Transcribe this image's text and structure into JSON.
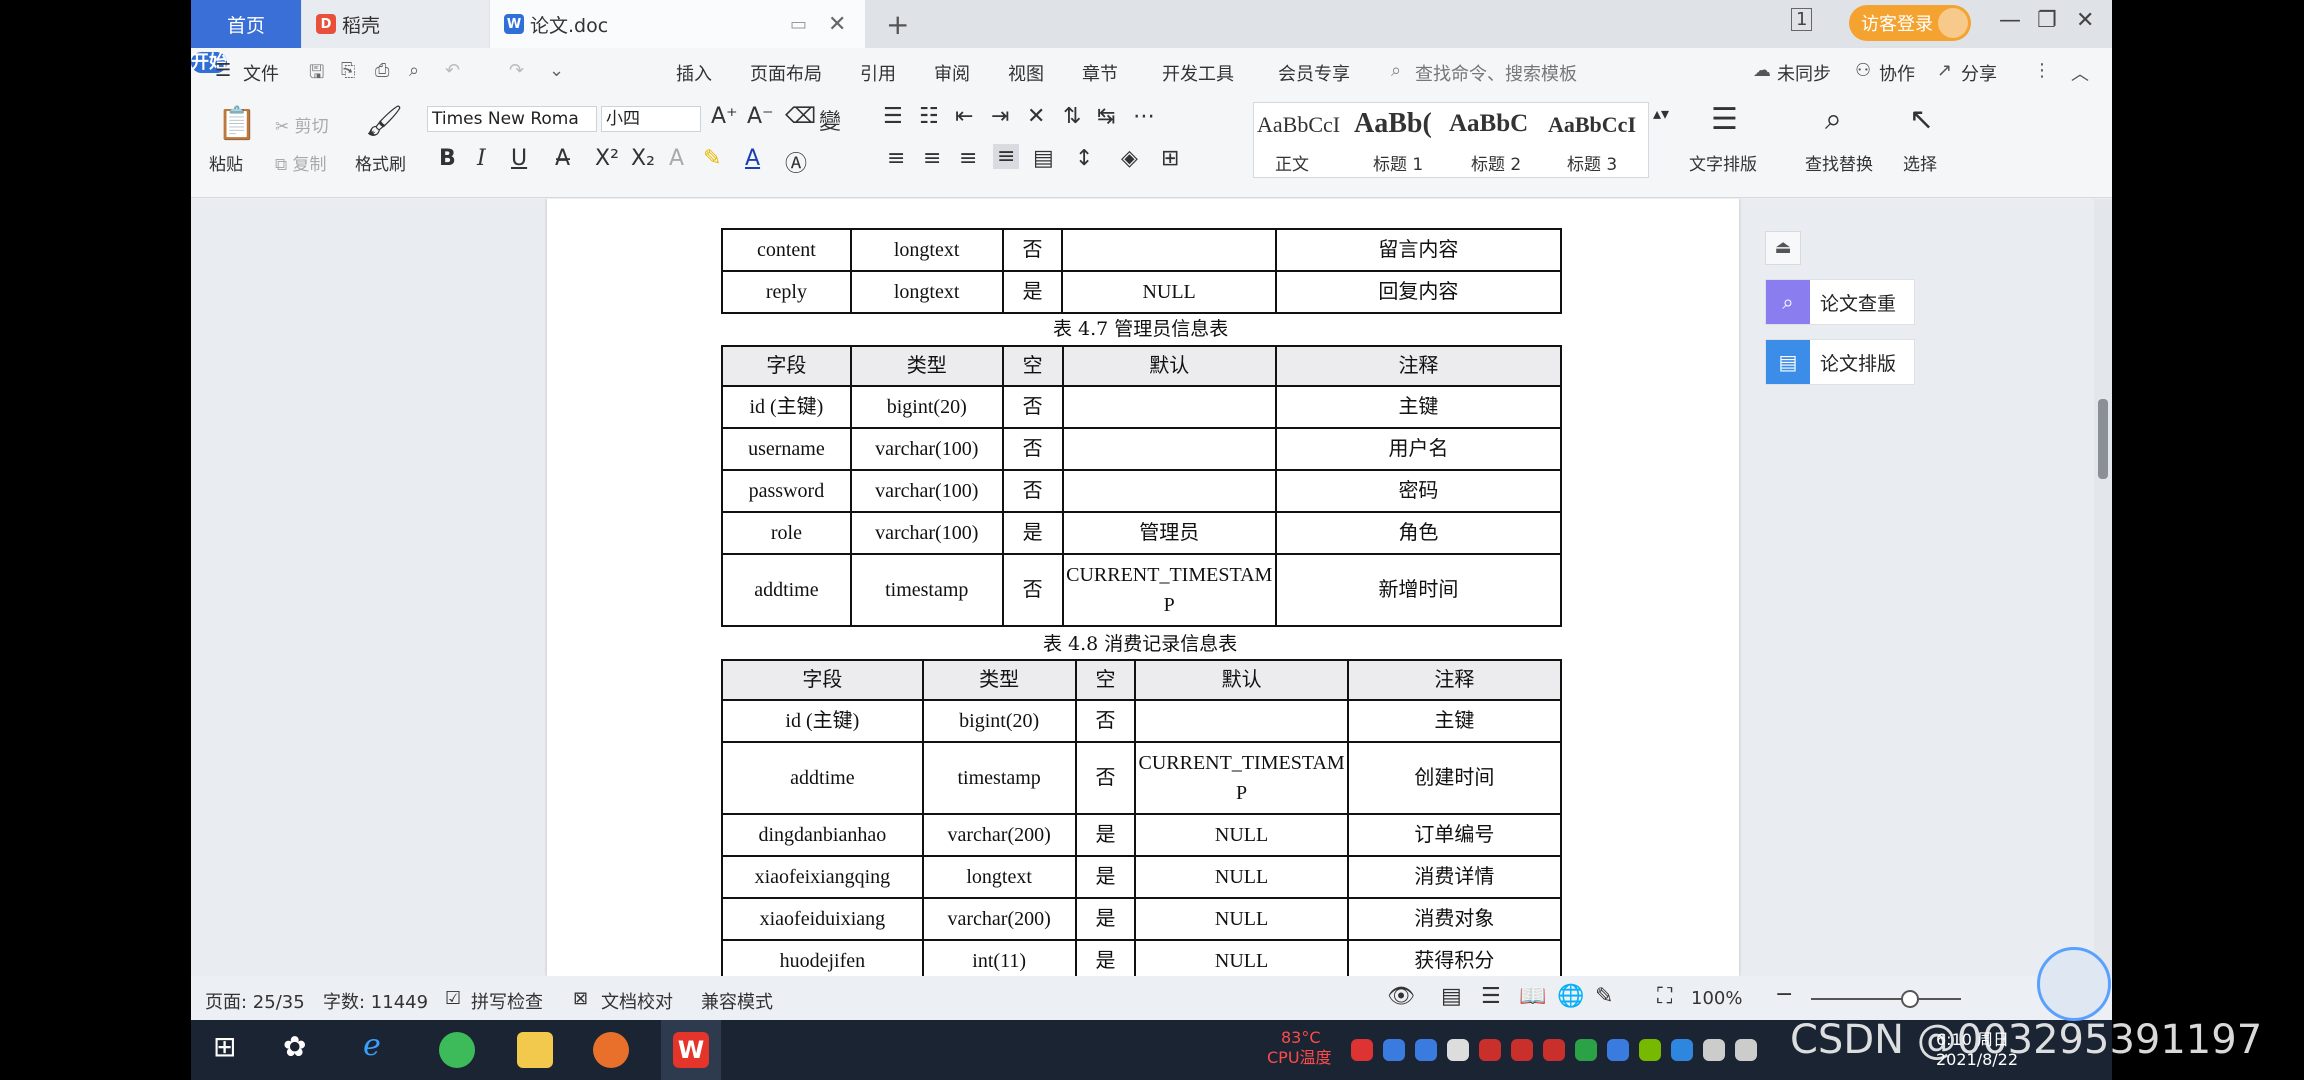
{
  "tabs": {
    "home": "首页",
    "daoke": "稻壳",
    "doc": "论文.doc",
    "visitor": "访客登录"
  },
  "menu": {
    "file": "文件",
    "items": [
      "开始",
      "插入",
      "页面布局",
      "引用",
      "审阅",
      "视图",
      "章节",
      "开发工具",
      "会员专享"
    ],
    "search": "查找命令、搜索模板",
    "sync": "未同步",
    "collab": "协作",
    "share": "分享"
  },
  "ribbon": {
    "paste": "粘贴",
    "cut": "剪切",
    "copy": "复制",
    "format_painter": "格式刷",
    "font": "Times New Roma",
    "size": "小四",
    "styles": [
      {
        "preview": "AaBbCcI",
        "label": "正文"
      },
      {
        "preview": "AaBb(",
        "label": "标题 1"
      },
      {
        "preview": "AaBbC",
        "label": "标题 2"
      },
      {
        "preview": "AaBbCcI",
        "label": "标题 3"
      }
    ],
    "text_layout": "文字排版",
    "find_replace": "查找替换",
    "select": "选择"
  },
  "doc": {
    "top_table": {
      "rows": [
        [
          "content",
          "longtext",
          "否",
          "",
          "留言内容"
        ],
        [
          "reply",
          "longtext",
          "是",
          "NULL",
          "回复内容"
        ]
      ]
    },
    "caption1": "表 4.7  管理员信息表",
    "table1": {
      "headers": [
        "字段",
        "类型",
        "空",
        "默认",
        "注释"
      ],
      "rows": [
        [
          "id (主键)",
          "bigint(20)",
          "否",
          "",
          "主键"
        ],
        [
          "username",
          "varchar(100)",
          "否",
          "",
          "用户名"
        ],
        [
          "password",
          "varchar(100)",
          "否",
          "",
          "密码"
        ],
        [
          "role",
          "varchar(100)",
          "是",
          "管理员",
          "角色"
        ],
        [
          "addtime",
          "timestamp",
          "否",
          "CURRENT_TIMESTAMP",
          "新增时间"
        ]
      ]
    },
    "caption2": "表 4.8  消费记录信息表",
    "table2": {
      "headers": [
        "字段",
        "类型",
        "空",
        "默认",
        "注释"
      ],
      "rows": [
        [
          "id (主键)",
          "bigint(20)",
          "否",
          "",
          "主键"
        ],
        [
          "addtime",
          "timestamp",
          "否",
          "CURRENT_TIMESTAMP",
          "创建时间"
        ],
        [
          "dingdanbianhao",
          "varchar(200)",
          "是",
          "NULL",
          "订单编号"
        ],
        [
          "xiaofeixiangqing",
          "longtext",
          "是",
          "NULL",
          "消费详情"
        ],
        [
          "xiaofeiduixiang",
          "varchar(200)",
          "是",
          "NULL",
          "消费对象"
        ],
        [
          "huodejifen",
          "int(11)",
          "是",
          "NULL",
          "获得积分"
        ]
      ]
    }
  },
  "panel": {
    "check": "论文查重",
    "layout": "论文排版"
  },
  "status": {
    "page": "页面: 25/35",
    "words": "字数: 11449",
    "spell": "拼写检查",
    "proof": "文档校对",
    "compat": "兼容模式",
    "zoom": "100%"
  },
  "taskbar": {
    "cpu_temp": "83°C",
    "cpu_label": "CPU温度",
    "time": "6:10 周日",
    "date": "2021/8/22"
  },
  "watermark": "CSDN @0032953911​97"
}
